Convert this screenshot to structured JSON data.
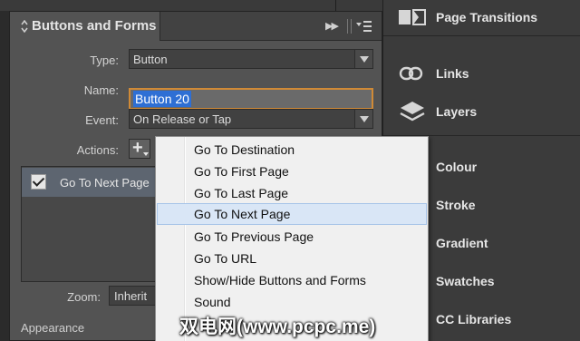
{
  "panel": {
    "title": "Buttons and Forms",
    "type_label": "Type:",
    "type_value": "Button",
    "name_label": "Name:",
    "name_value": "Button 20",
    "event_label": "Event:",
    "event_value": "On Release or Tap",
    "actions_label": "Actions:",
    "actions": [
      {
        "label": "Go To Next Page",
        "checked": true
      }
    ],
    "zoom_label": "Zoom:",
    "zoom_value": "Inherit",
    "appearance_label": "Appearance"
  },
  "menu": {
    "items": [
      {
        "label": "Go To Destination",
        "selected": false
      },
      {
        "label": "Go To First Page",
        "selected": false
      },
      {
        "label": "Go To Last Page",
        "selected": false
      },
      {
        "label": "Go To Next Page",
        "selected": true
      },
      {
        "label": "Go To Previous Page",
        "selected": false
      },
      {
        "label": "Go To URL",
        "selected": false
      },
      {
        "label": "Show/Hide Buttons and Forms",
        "selected": false
      },
      {
        "label": "Sound",
        "selected": false
      }
    ]
  },
  "dock": {
    "items": [
      {
        "label": "Page Transitions",
        "icon": "page-transitions-icon"
      },
      {
        "label": "Links",
        "icon": "links-icon"
      },
      {
        "label": "Layers",
        "icon": "layers-icon"
      },
      {
        "label": "Colour",
        "icon": ""
      },
      {
        "label": "Stroke",
        "icon": ""
      },
      {
        "label": "Gradient",
        "icon": ""
      },
      {
        "label": "Swatches",
        "icon": ""
      },
      {
        "label": "CC Libraries",
        "icon": ""
      }
    ]
  },
  "watermark": "双电网(www.pcpc.me)",
  "colors": {
    "panel_bg": "#535353",
    "dock_bg": "#3b3b3b",
    "focus_border": "#d08a36",
    "selection_blue": "#2e6fd4",
    "menu_bg": "#f0f0f0",
    "menu_highlight": "#d9e6f6"
  }
}
